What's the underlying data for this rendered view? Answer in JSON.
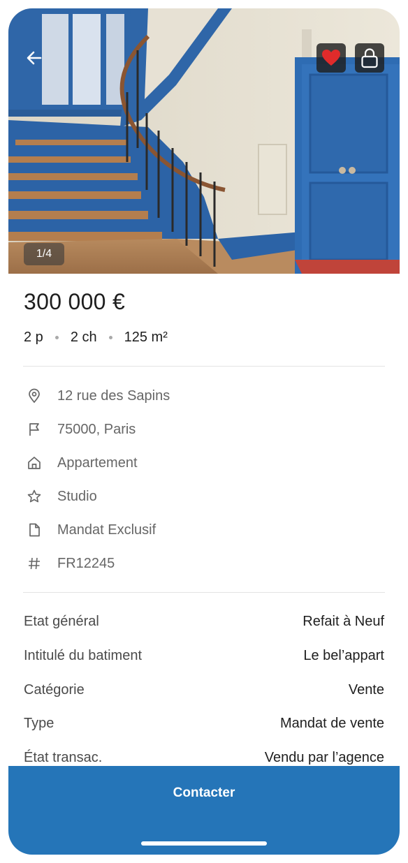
{
  "gallery": {
    "counter": "1/4",
    "photo": "staircase-interior-photo"
  },
  "header": {
    "back_icon": "arrow-left-icon",
    "favorite_icon": "heart-icon",
    "favorite_color": "#e02b2b",
    "lock_icon": "lock-icon"
  },
  "listing": {
    "price": "300 000 €",
    "rooms": "2 p",
    "bedrooms": "2 ch",
    "surface": "125 m²"
  },
  "info": [
    {
      "icon": "map-pin-icon",
      "text": "12 rue des Sapins"
    },
    {
      "icon": "flag-icon",
      "text": "75000, Paris"
    },
    {
      "icon": "home-icon",
      "text": "Appartement"
    },
    {
      "icon": "star-icon",
      "text": "Studio"
    },
    {
      "icon": "file-icon",
      "text": "Mandat Exclusif"
    },
    {
      "icon": "hash-icon",
      "text": "FR12245"
    }
  ],
  "details": [
    {
      "label": "Etat général",
      "value": "Refait à Neuf"
    },
    {
      "label": "Intitulé du batiment",
      "value": "Le bel’appart"
    },
    {
      "label": "Catégorie",
      "value": "Vente"
    },
    {
      "label": "Type",
      "value": "Mandat de vente"
    },
    {
      "label": "État transac.",
      "value": "Vendu par l’agence"
    }
  ],
  "cta": {
    "label": "Contacter",
    "color": "#2575b8"
  }
}
